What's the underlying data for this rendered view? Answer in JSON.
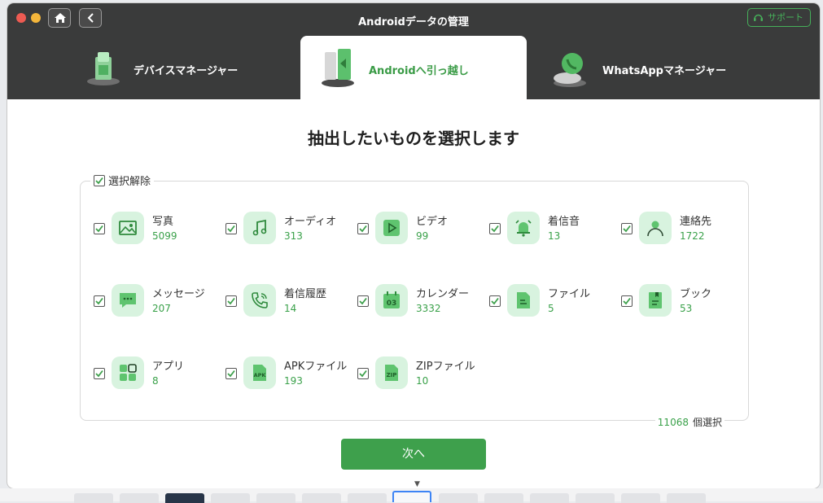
{
  "window": {
    "title": "Androidデータの管理",
    "support_label": "サポート"
  },
  "tabs": [
    {
      "label": "デバイスマネージャー",
      "icon": "device-manager-icon",
      "active": false
    },
    {
      "label": "Androidへ引っ越し",
      "icon": "android-transfer-icon",
      "active": true
    },
    {
      "label": "WhatsAppマネージャー",
      "icon": "whatsapp-manager-icon",
      "active": false
    }
  ],
  "content": {
    "title": "抽出したいものを選択します",
    "deselect_all_label": "選択解除",
    "items": [
      {
        "name": "写真",
        "count": "5099",
        "icon": "photo-icon"
      },
      {
        "name": "オーディオ",
        "count": "313",
        "icon": "music-icon"
      },
      {
        "name": "ビデオ",
        "count": "99",
        "icon": "video-icon"
      },
      {
        "name": "着信音",
        "count": "13",
        "icon": "bell-icon"
      },
      {
        "name": "連絡先",
        "count": "1722",
        "icon": "contact-icon"
      },
      {
        "name": "メッセージ",
        "count": "207",
        "icon": "message-icon"
      },
      {
        "name": "着信履歴",
        "count": "14",
        "icon": "phone-icon"
      },
      {
        "name": "カレンダー",
        "count": "3332",
        "icon": "calendar-icon"
      },
      {
        "name": "ファイル",
        "count": "5",
        "icon": "file-icon"
      },
      {
        "name": "ブック",
        "count": "53",
        "icon": "book-icon"
      },
      {
        "name": "アプリ",
        "count": "8",
        "icon": "apps-icon"
      },
      {
        "name": "APKファイル",
        "count": "193",
        "icon": "apk-icon"
      },
      {
        "name": "ZIPファイル",
        "count": "10",
        "icon": "zip-icon"
      }
    ],
    "calendar_icon_text": "03",
    "apk_icon_text": "APK",
    "zip_icon_text": "ZIP",
    "total_count": "11068",
    "total_suffix": "個選択",
    "next_label": "次へ"
  },
  "colors": {
    "accent": "#3ea04c",
    "titlebar": "#3a3b3b",
    "icon_bg": "#d8f3df"
  }
}
